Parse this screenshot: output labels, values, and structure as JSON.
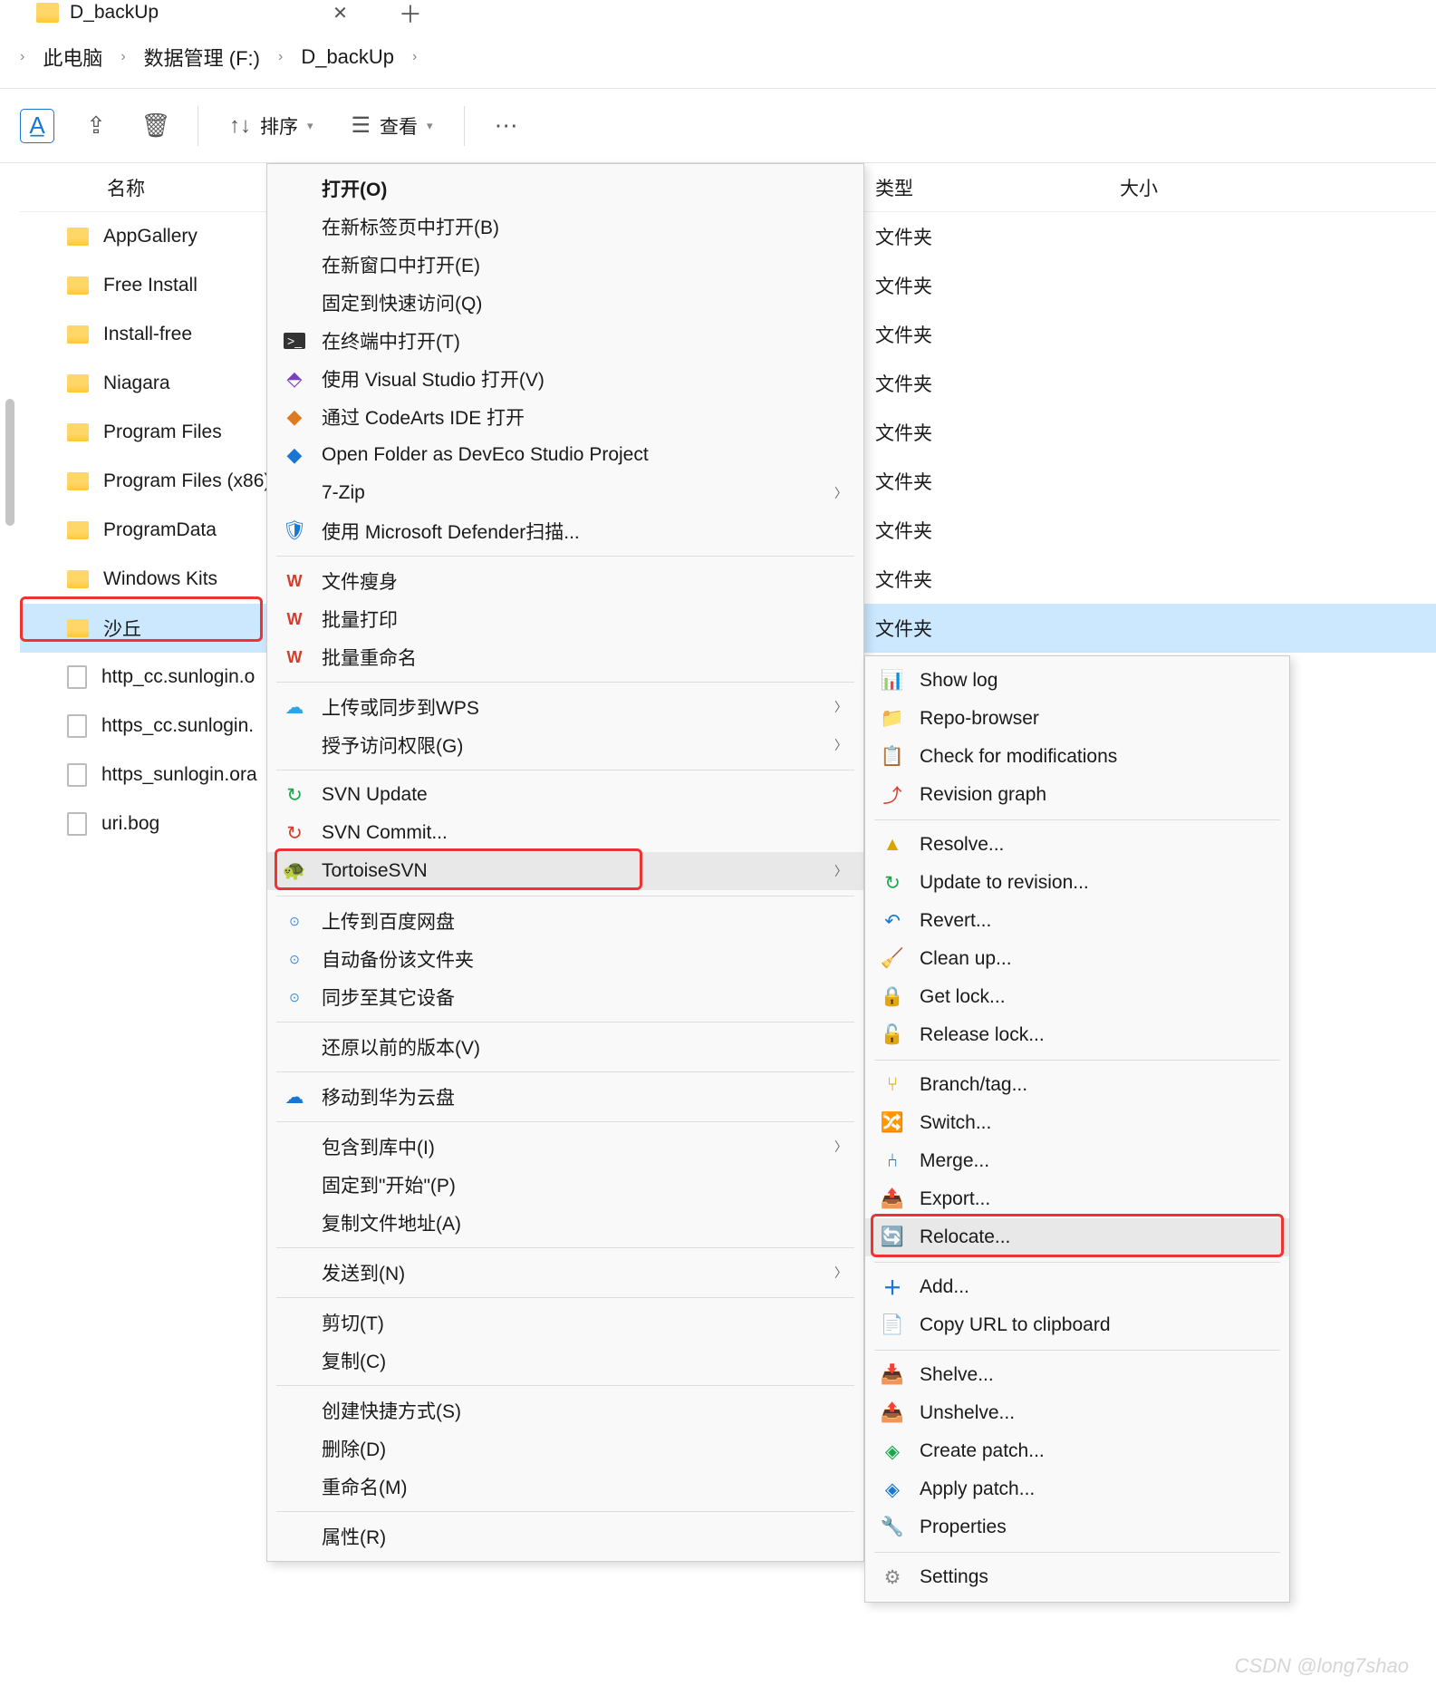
{
  "tab": {
    "title": "D_backUp"
  },
  "breadcrumbs": [
    "此电脑",
    "数据管理 (F:)",
    "D_backUp"
  ],
  "toolbar": {
    "sort": "排序",
    "view": "查看"
  },
  "columns": {
    "name": "名称",
    "type": "类型",
    "size": "大小"
  },
  "rows": [
    {
      "name": "AppGallery",
      "type": "文件夹",
      "kind": "folder"
    },
    {
      "name": "Free Install",
      "type": "文件夹",
      "kind": "folder"
    },
    {
      "name": "Install-free",
      "type": "文件夹",
      "kind": "folder"
    },
    {
      "name": "Niagara",
      "type": "文件夹",
      "kind": "folder"
    },
    {
      "name": "Program Files",
      "type": "文件夹",
      "kind": "folder"
    },
    {
      "name": "Program Files (x86)",
      "type": "文件夹",
      "kind": "folder"
    },
    {
      "name": "ProgramData",
      "type": "文件夹",
      "kind": "folder"
    },
    {
      "name": "Windows Kits",
      "type": "文件夹",
      "kind": "folder"
    },
    {
      "name": "沙丘",
      "type": "文件夹",
      "kind": "folder",
      "selected": true,
      "boxed": true
    },
    {
      "name": "http_cc.sunlogin.o",
      "type": "",
      "kind": "file"
    },
    {
      "name": "https_cc.sunlogin.",
      "type": "",
      "kind": "file"
    },
    {
      "name": "https_sunlogin.ora",
      "type": "",
      "kind": "file"
    },
    {
      "name": "uri.bog",
      "type": "",
      "kind": "file"
    }
  ],
  "menu1": {
    "g0": [
      {
        "label": "打开(O)",
        "bold": true
      },
      {
        "label": "在新标签页中打开(B)"
      },
      {
        "label": "在新窗口中打开(E)"
      },
      {
        "label": "固定到快速访问(Q)"
      },
      {
        "label": "在终端中打开(T)",
        "icon": "terminal"
      },
      {
        "label": "使用 Visual Studio 打开(V)",
        "icon": "vs"
      },
      {
        "label": "通过 CodeArts IDE 打开",
        "icon": "codearts"
      },
      {
        "label": "Open Folder as DevEco Studio Project",
        "icon": "deveco"
      },
      {
        "label": "7-Zip",
        "sub": true
      },
      {
        "label": "使用 Microsoft Defender扫描...",
        "icon": "shield"
      }
    ],
    "g1": [
      {
        "label": "文件瘦身",
        "icon": "ws"
      },
      {
        "label": "批量打印",
        "icon": "ws"
      },
      {
        "label": "批量重命名",
        "icon": "ws"
      }
    ],
    "g2": [
      {
        "label": "上传或同步到WPS",
        "sub": true,
        "icon": "cloud"
      },
      {
        "label": "授予访问权限(G)",
        "sub": true
      }
    ],
    "g3": [
      {
        "label": "SVN Update",
        "icon": "svn-g"
      },
      {
        "label": "SVN Commit...",
        "icon": "svn-r"
      },
      {
        "label": "TortoiseSVN",
        "sub": true,
        "icon": "tortoise",
        "hover": true,
        "boxed": true
      }
    ],
    "g4": [
      {
        "label": "上传到百度网盘",
        "icon": "baidu"
      },
      {
        "label": "自动备份该文件夹",
        "icon": "baidu"
      },
      {
        "label": "同步至其它设备",
        "icon": "baidu"
      }
    ],
    "g5": {
      "label": "还原以前的版本(V)"
    },
    "g6": {
      "label": "移动到华为云盘",
      "icon": "huawei"
    },
    "g7": [
      {
        "label": "包含到库中(I)",
        "sub": true
      },
      {
        "label": "固定到\"开始\"(P)"
      },
      {
        "label": "复制文件地址(A)"
      }
    ],
    "g8": {
      "label": "发送到(N)",
      "sub": true
    },
    "g9": [
      {
        "label": "剪切(T)"
      },
      {
        "label": "复制(C)"
      }
    ],
    "g10": [
      {
        "label": "创建快捷方式(S)"
      },
      {
        "label": "删除(D)"
      },
      {
        "label": "重命名(M)"
      }
    ],
    "g11": {
      "label": "属性(R)"
    }
  },
  "menu2": {
    "g0": [
      {
        "label": "Show log",
        "icon": "log"
      },
      {
        "label": "Repo-browser",
        "icon": "repo"
      },
      {
        "label": "Check for modifications",
        "icon": "check"
      },
      {
        "label": "Revision graph",
        "icon": "graph"
      }
    ],
    "g1": [
      {
        "label": "Resolve...",
        "icon": "resolve"
      },
      {
        "label": "Update to revision...",
        "icon": "update"
      },
      {
        "label": "Revert...",
        "icon": "revert"
      },
      {
        "label": "Clean up...",
        "icon": "clean"
      },
      {
        "label": "Get lock...",
        "icon": "lock"
      },
      {
        "label": "Release lock...",
        "icon": "unlock"
      }
    ],
    "g2": [
      {
        "label": "Branch/tag...",
        "icon": "branch"
      },
      {
        "label": "Switch...",
        "icon": "switch"
      },
      {
        "label": "Merge...",
        "icon": "merge"
      },
      {
        "label": "Export...",
        "icon": "export"
      },
      {
        "label": "Relocate...",
        "icon": "relocate",
        "hover": true,
        "boxed": true
      }
    ],
    "g3": [
      {
        "label": "Add...",
        "icon": "add"
      },
      {
        "label": "Copy URL to clipboard",
        "icon": "copy"
      }
    ],
    "g4": [
      {
        "label": "Shelve...",
        "icon": "shelve"
      },
      {
        "label": "Unshelve...",
        "icon": "unshelve"
      },
      {
        "label": "Create patch...",
        "icon": "patch"
      },
      {
        "label": "Apply patch...",
        "icon": "apply"
      },
      {
        "label": "Properties",
        "icon": "props"
      }
    ],
    "g5": {
      "label": "Settings",
      "icon": "settings"
    }
  },
  "watermark": "CSDN @long7shao"
}
